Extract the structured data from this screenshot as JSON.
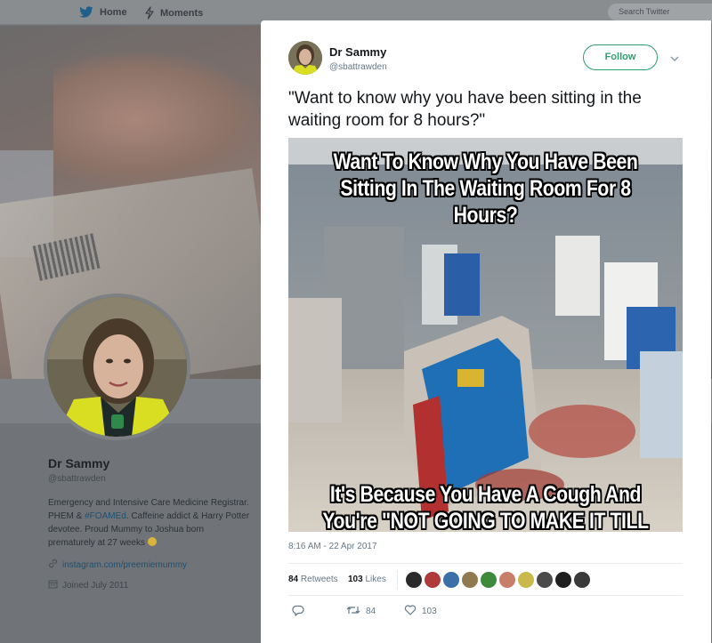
{
  "nav": {
    "home_label": "Home",
    "moments_label": "Moments",
    "search_placeholder": "Search Twitter"
  },
  "profile": {
    "name": "Dr Sammy",
    "handle": "@sbattrawden",
    "bio_part1": "Emergency and Intensive Care Medicine Registrar. PHEM & ",
    "bio_hashtag": "#FOAMEd",
    "bio_part2": ". Caffeine addict & Harry Potter devotee. Proud Mummy to Joshua born prematurely at 27 weeks ",
    "link": "instagram.com/preemiemummy",
    "joined": "Joined July 2011"
  },
  "tweet": {
    "author_name": "Dr Sammy",
    "author_handle": "@sbattrawden",
    "follow_label": "Follow",
    "text": "\"Want to know why you have been sitting in the waiting room for 8 hours?\"",
    "image_caption_top": "Want To Know Why You Have Been Sitting In The Waiting Room For 8 Hours?",
    "image_caption_bottom": "It's Because You Have A Cough And You're \"NOT GOING TO MAKE IT TILL",
    "timestamp": "8:16 AM - 22 Apr 2017",
    "retweets_count": "84",
    "retweets_label": "Retweets",
    "likes_count": "103",
    "likes_label": "Likes",
    "retweet_action_count": "84",
    "like_action_count": "103"
  },
  "icons": {
    "home": "twitter-bird-icon",
    "moments": "lightning-icon",
    "link": "link-icon",
    "calendar": "calendar-icon",
    "reply": "reply-icon",
    "retweet": "retweet-icon",
    "like": "heart-icon",
    "caret": "chevron-down-icon"
  },
  "colors": {
    "follow_accent": "#2f9e6e",
    "link_color": "#1f4f6e",
    "muted_text": "#657786"
  }
}
